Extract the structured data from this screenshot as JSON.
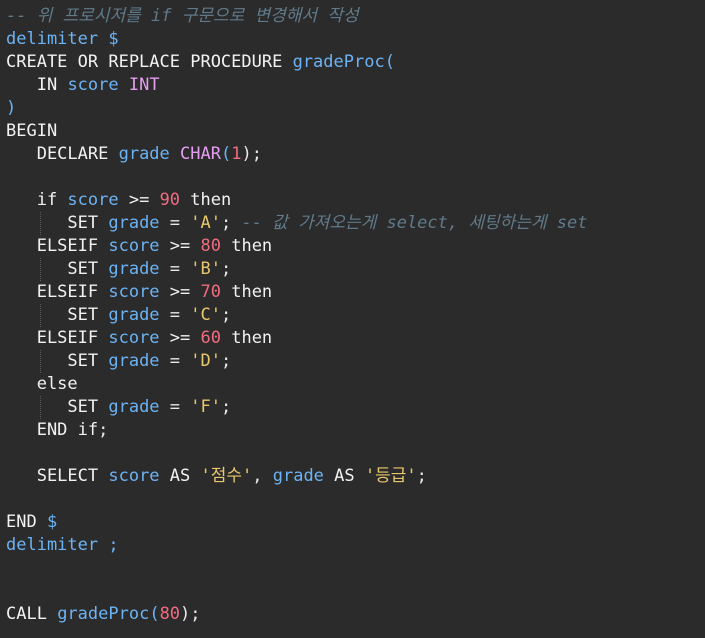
{
  "editor": {
    "lines": [
      {
        "tokens": [
          {
            "t": "-- 위 프로시저를 if 구문으로 변경해서 작성",
            "c": "cmt"
          }
        ]
      },
      {
        "tokens": [
          {
            "t": "delimiter ",
            "c": "id"
          },
          {
            "t": "$",
            "c": "id"
          }
        ]
      },
      {
        "tokens": [
          {
            "t": "CREATE OR REPLACE PROCEDURE ",
            "c": "kw"
          },
          {
            "t": "gradeProc",
            "c": "id"
          },
          {
            "t": "(",
            "c": "id"
          }
        ]
      },
      {
        "tokens": [
          {
            "t": "   ",
            "c": "kw"
          },
          {
            "t": "IN ",
            "c": "kw"
          },
          {
            "t": "score ",
            "c": "id"
          },
          {
            "t": "INT",
            "c": "typ"
          }
        ]
      },
      {
        "tokens": [
          {
            "t": ")",
            "c": "id"
          }
        ]
      },
      {
        "tokens": [
          {
            "t": "BEGIN",
            "c": "kw"
          }
        ]
      },
      {
        "tokens": [
          {
            "t": "   DECLARE ",
            "c": "kw"
          },
          {
            "t": "grade ",
            "c": "id"
          },
          {
            "t": "CHAR",
            "c": "typ"
          },
          {
            "t": "(",
            "c": "id"
          },
          {
            "t": "1",
            "c": "num"
          },
          {
            "t": ");",
            "c": "op"
          }
        ]
      },
      {
        "tokens": []
      },
      {
        "tokens": [
          {
            "t": "   if ",
            "c": "kw"
          },
          {
            "t": "score ",
            "c": "id"
          },
          {
            "t": ">= ",
            "c": "kw"
          },
          {
            "t": "90 ",
            "c": "num"
          },
          {
            "t": "then",
            "c": "kw"
          }
        ]
      },
      {
        "tokens": [
          {
            "t": "      SET ",
            "c": "kw"
          },
          {
            "t": "grade ",
            "c": "id"
          },
          {
            "t": "= ",
            "c": "op"
          },
          {
            "t": "'A'",
            "c": "str"
          },
          {
            "t": "; ",
            "c": "op"
          },
          {
            "t": "-- 값 가져오는게 select, 세팅하는게 set",
            "c": "cmt"
          }
        ]
      },
      {
        "tokens": [
          {
            "t": "   ELSEIF ",
            "c": "kw"
          },
          {
            "t": "score ",
            "c": "id"
          },
          {
            "t": ">= ",
            "c": "kw"
          },
          {
            "t": "80 ",
            "c": "num"
          },
          {
            "t": "then",
            "c": "kw"
          }
        ]
      },
      {
        "tokens": [
          {
            "t": "      SET ",
            "c": "kw"
          },
          {
            "t": "grade ",
            "c": "id"
          },
          {
            "t": "= ",
            "c": "op"
          },
          {
            "t": "'B'",
            "c": "str"
          },
          {
            "t": ";",
            "c": "op"
          }
        ]
      },
      {
        "tokens": [
          {
            "t": "   ELSEIF ",
            "c": "kw"
          },
          {
            "t": "score ",
            "c": "id"
          },
          {
            "t": ">= ",
            "c": "kw"
          },
          {
            "t": "70 ",
            "c": "num"
          },
          {
            "t": "then",
            "c": "kw"
          }
        ]
      },
      {
        "tokens": [
          {
            "t": "      SET ",
            "c": "kw"
          },
          {
            "t": "grade ",
            "c": "id"
          },
          {
            "t": "= ",
            "c": "op"
          },
          {
            "t": "'C'",
            "c": "str"
          },
          {
            "t": ";",
            "c": "op"
          }
        ]
      },
      {
        "tokens": [
          {
            "t": "   ELSEIF ",
            "c": "kw"
          },
          {
            "t": "score ",
            "c": "id"
          },
          {
            "t": ">= ",
            "c": "kw"
          },
          {
            "t": "60 ",
            "c": "num"
          },
          {
            "t": "then",
            "c": "kw"
          }
        ]
      },
      {
        "tokens": [
          {
            "t": "      SET ",
            "c": "kw"
          },
          {
            "t": "grade ",
            "c": "id"
          },
          {
            "t": "= ",
            "c": "op"
          },
          {
            "t": "'D'",
            "c": "str"
          },
          {
            "t": ";",
            "c": "op"
          }
        ]
      },
      {
        "tokens": [
          {
            "t": "   else",
            "c": "kw"
          }
        ]
      },
      {
        "tokens": [
          {
            "t": "      SET ",
            "c": "kw"
          },
          {
            "t": "grade ",
            "c": "id"
          },
          {
            "t": "= ",
            "c": "op"
          },
          {
            "t": "'F'",
            "c": "str"
          },
          {
            "t": ";",
            "c": "op"
          }
        ]
      },
      {
        "tokens": [
          {
            "t": "   END if",
            "c": "kw"
          },
          {
            "t": ";",
            "c": "op"
          }
        ]
      },
      {
        "tokens": []
      },
      {
        "tokens": [
          {
            "t": "   SELECT ",
            "c": "kw"
          },
          {
            "t": "score ",
            "c": "id"
          },
          {
            "t": "AS ",
            "c": "kw"
          },
          {
            "t": "'점수'",
            "c": "str"
          },
          {
            "t": ", ",
            "c": "op"
          },
          {
            "t": "grade ",
            "c": "id"
          },
          {
            "t": "AS ",
            "c": "kw"
          },
          {
            "t": "'등급'",
            "c": "str"
          },
          {
            "t": ";",
            "c": "op"
          }
        ]
      },
      {
        "tokens": []
      },
      {
        "tokens": [
          {
            "t": "END ",
            "c": "kw"
          },
          {
            "t": "$",
            "c": "id"
          }
        ]
      },
      {
        "tokens": [
          {
            "t": "delimiter ;",
            "c": "id"
          }
        ]
      },
      {
        "tokens": []
      },
      {
        "tokens": []
      },
      {
        "tokens": [
          {
            "t": "CALL ",
            "c": "kw"
          },
          {
            "t": "gradeProc",
            "c": "id"
          },
          {
            "t": "(",
            "c": "id"
          },
          {
            "t": "80",
            "c": "num"
          },
          {
            "t": ");",
            "c": "op"
          }
        ]
      }
    ]
  }
}
